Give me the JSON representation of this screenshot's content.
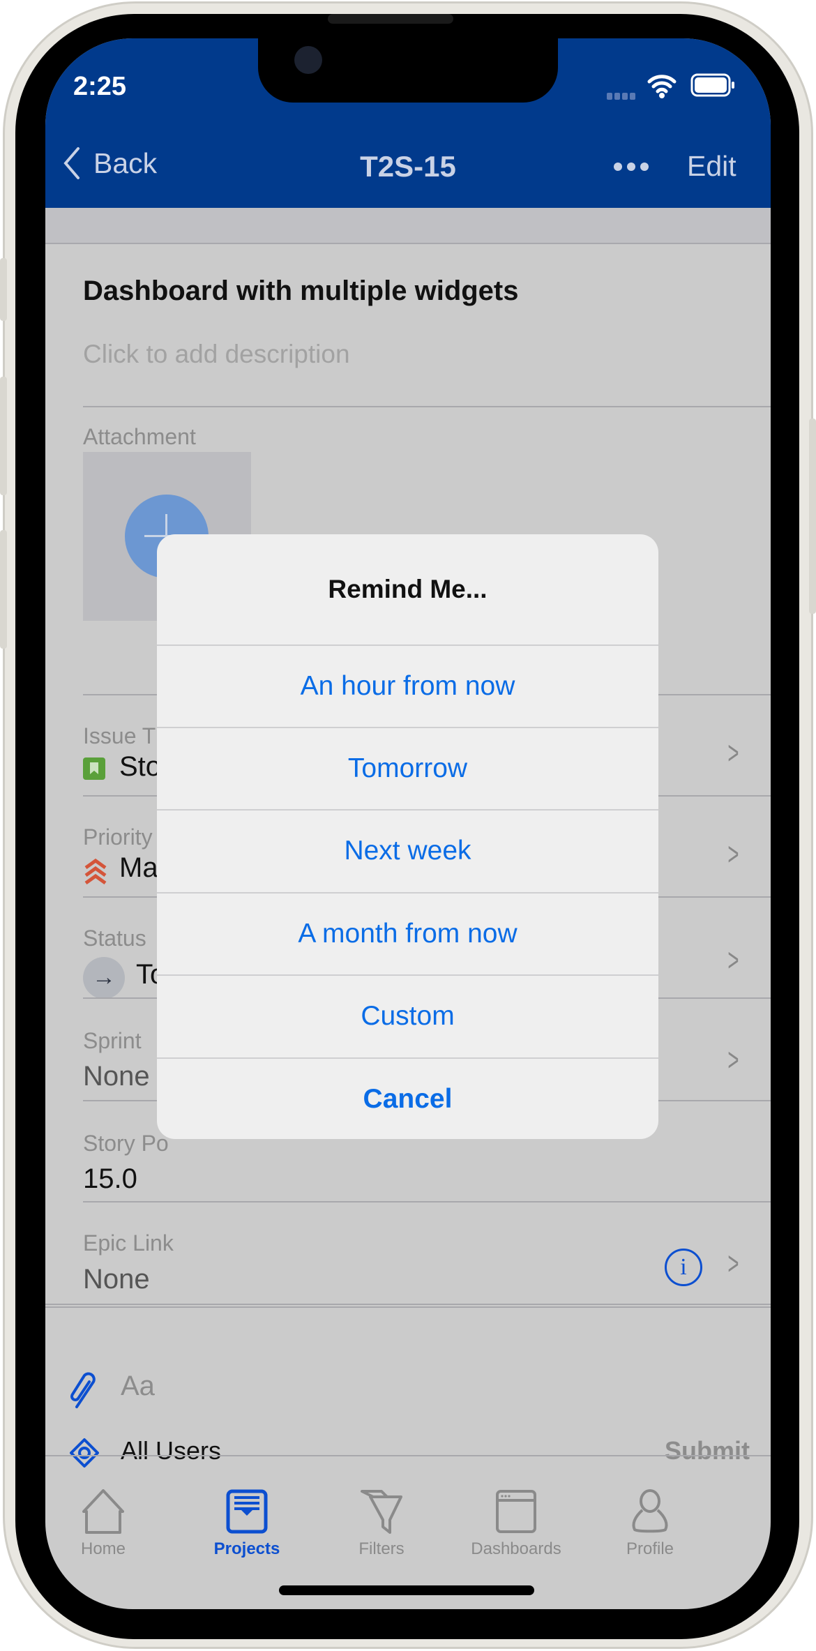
{
  "status_bar": {
    "time": "2:25",
    "icons": [
      "wifi-icon",
      "battery-icon"
    ]
  },
  "nav": {
    "back_label": "Back",
    "title": "T2S-15",
    "more_icon": "ellipsis-icon",
    "edit_label": "Edit"
  },
  "issue": {
    "summary": "Dashboard with multiple widgets",
    "description_placeholder": "Click to add description",
    "attachment_label": "Attachment"
  },
  "fields": [
    {
      "label": "Issue T",
      "value": "Sto",
      "icon": "story-icon"
    },
    {
      "label": "Priority",
      "value": "Ma",
      "icon": "priority-highest-icon"
    },
    {
      "label": "Status",
      "value": "To",
      "icon": "arrow-right-icon"
    },
    {
      "label": "Sprint",
      "value": "None"
    },
    {
      "label": "Story Po",
      "value": "15.0"
    },
    {
      "label": "Epic Link",
      "value": "None",
      "icon": "info-icon"
    }
  ],
  "comment": {
    "placeholder": "Aa",
    "visibility": "All Users",
    "submit_label": "Submit"
  },
  "dialog": {
    "title": "Remind Me...",
    "options": [
      "An hour from now",
      "Tomorrow",
      "Next week",
      "A month from now",
      "Custom"
    ],
    "cancel": "Cancel"
  },
  "tabs": [
    {
      "label": "Home"
    },
    {
      "label": "Projects",
      "active": true
    },
    {
      "label": "Filters"
    },
    {
      "label": "Dashboards"
    },
    {
      "label": "Profile"
    }
  ],
  "colors": {
    "nav": "#013a8c",
    "accent": "#0a6ce6",
    "tab_active": "#0c4fd0"
  }
}
